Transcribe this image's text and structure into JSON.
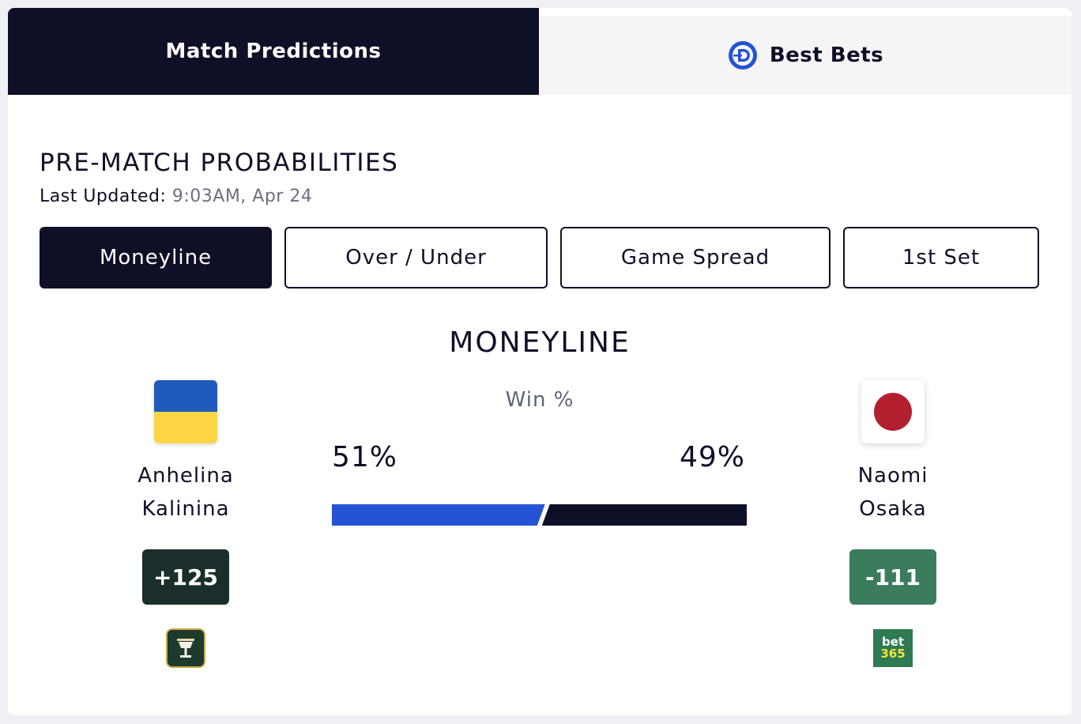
{
  "tabs": {
    "match_predictions": "Match Predictions",
    "best_bets": "Best Bets"
  },
  "section": {
    "title": "PRE-MATCH PROBABILITIES",
    "updated_label": "Last Updated:",
    "updated_value": "9:03AM, Apr 24"
  },
  "markets": [
    "Moneyline",
    "Over / Under",
    "Game Spread",
    "1st Set"
  ],
  "active_market": "Moneyline",
  "moneyline": {
    "title": "MONEYLINE",
    "win_label": "Win %",
    "left": {
      "name_line1": "Anhelina",
      "name_line2": "Kalinina",
      "flag": "ukraine-flag",
      "win_pct": "51%",
      "win_value": 51,
      "odds": "+125",
      "book_icon": "trophy-cup-icon"
    },
    "right": {
      "name_line1": "Naomi",
      "name_line2": "Osaka",
      "flag": "japan-flag",
      "win_pct": "49%",
      "win_value": 49,
      "odds": "-111",
      "book_icon": "bet365-logo",
      "book_line1": "bet",
      "book_line2": "365"
    }
  },
  "colors": {
    "navy": "#0f1027",
    "blue_bar": "#2453d4",
    "odds_dark": "#1a2e2b",
    "odds_green": "#3a7c5c"
  }
}
